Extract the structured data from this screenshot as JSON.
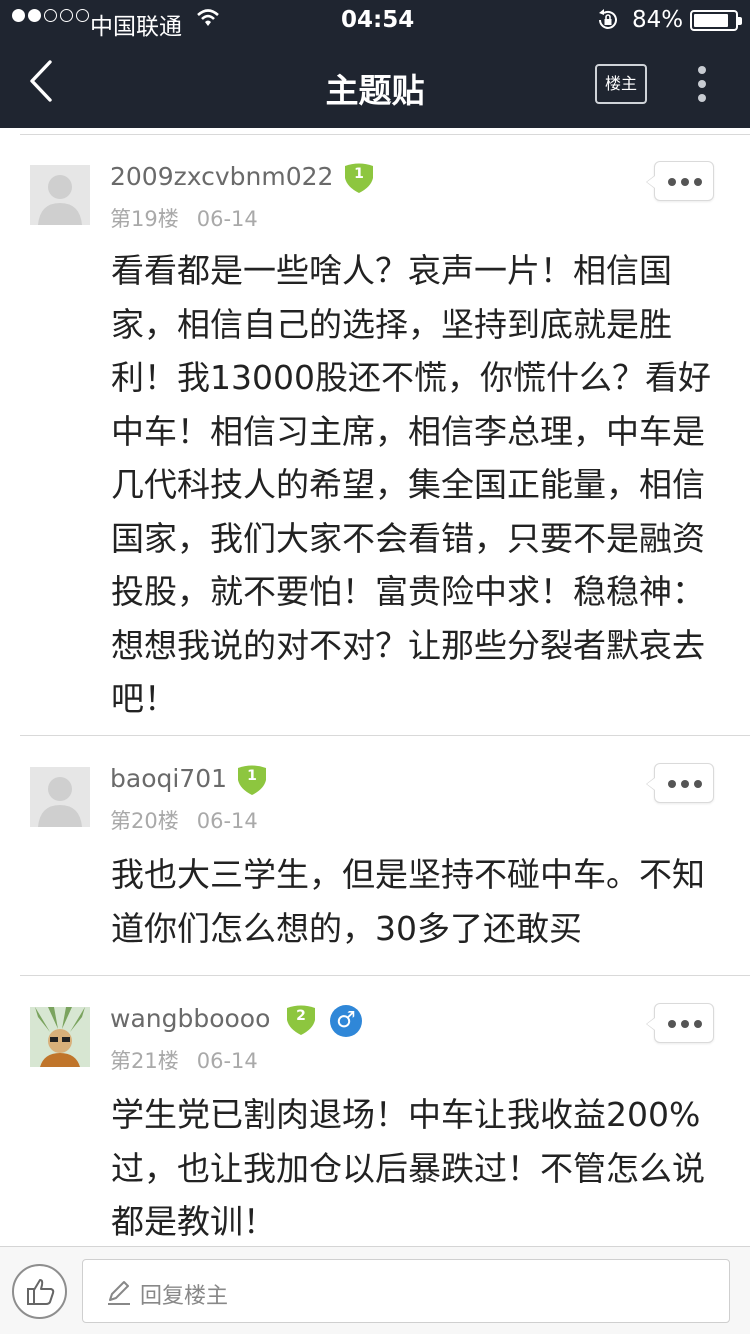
{
  "status_bar": {
    "carrier": "中国联通",
    "time": "04:54",
    "battery_percent": "84%",
    "battery_level": 0.84,
    "signal_filled": 2,
    "signal_total": 5
  },
  "nav": {
    "title": "主题贴",
    "owner_button": "楼主"
  },
  "colors": {
    "header_bg": "#1f2530",
    "level_badge": "#8dc63f",
    "gender_male": "#2f87d8"
  },
  "posts": [
    {
      "username": "2009zxcvbnm022",
      "level": "1",
      "floor": "第19楼",
      "date": "06-14",
      "avatar": "default-avatar-icon",
      "body": "看看都是一些啥人？哀声一片！相信国家，相信自己的选择，坚持到底就是胜利！我13000股还不慌，你慌什么？看好中车！相信习主席，相信李总理，中车是几代科技人的希望，集全国正能量，相信国家，我们大家不会看错，只要不是融资投股，就不要怕！富贵险中求！稳稳神：想想我说的对不对？让那些分裂者默哀去吧！"
    },
    {
      "username": "baoqi701",
      "level": "1",
      "floor": "第20楼",
      "date": "06-14",
      "avatar": "default-avatar-icon",
      "body": "我也大三学生，但是坚持不碰中车。不知道你们怎么想的，30多了还敢买"
    },
    {
      "username": "wangbboooo",
      "level": "2",
      "gender": "♂",
      "floor": "第21楼",
      "date": "06-14",
      "avatar": "custom-avatar-image",
      "body": "学生党已割肉退场！中车让我收益200%过，也让我加仓以后暴跌过！不管怎么说都是教训！"
    }
  ],
  "bottom_bar": {
    "reply_placeholder": "回复楼主",
    "like_icon": "thumbs-up-icon",
    "pen_icon": "pencil-icon"
  }
}
